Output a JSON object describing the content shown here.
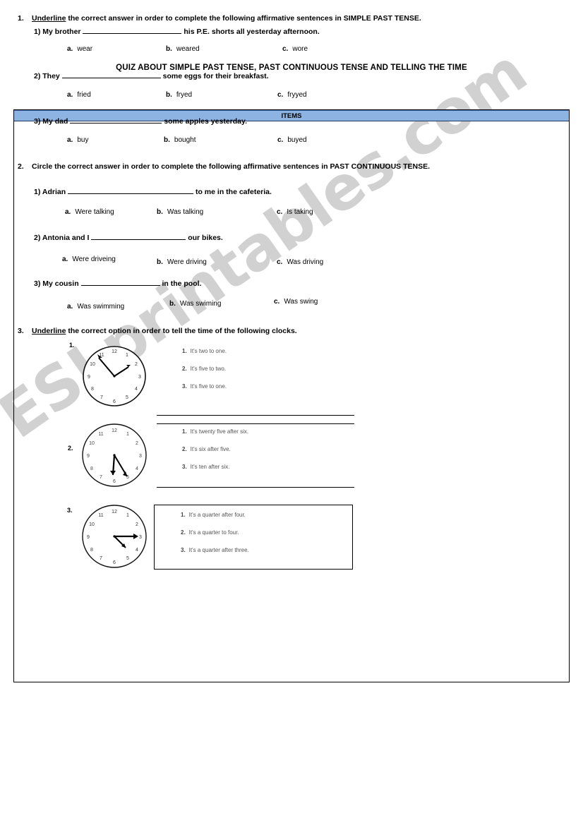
{
  "document": {
    "title": "QUIZ ABOUT SIMPLE PAST TENSE, PAST CONTINUOUS TENSE AND TELLING THE TIME",
    "watermark": "ESLprintables.com",
    "table_header": "ITEMS",
    "header_bg_color": "#8db3e2",
    "border_color": "#000000"
  },
  "sections": [
    {
      "number": "1.",
      "instruction_underlined": "Underline",
      "instruction_rest": " the correct answer in order to complete the following affirmative sentences in SIMPLE PAST TENSE.",
      "questions": [
        {
          "number": "1)",
          "before": "My brother",
          "after": "his P.E. shorts all yesterday afternoon.",
          "options": [
            {
              "letter": "a.",
              "text": "wear"
            },
            {
              "letter": "b.",
              "text": "weared"
            },
            {
              "letter": "c.",
              "text": "wore"
            }
          ]
        },
        {
          "number": "2)",
          "before": "They",
          "after": "some eggs for their breakfast.",
          "options": [
            {
              "letter": "a.",
              "text": "fried"
            },
            {
              "letter": "b.",
              "text": "fryed"
            },
            {
              "letter": "c.",
              "text": "fryyed"
            }
          ]
        },
        {
          "number": "3)",
          "before": "My dad",
          "after": "some apples yesterday.",
          "options": [
            {
              "letter": "a.",
              "text": "buy"
            },
            {
              "letter": "b.",
              "text": "bought"
            },
            {
              "letter": "c.",
              "text": "buyed"
            }
          ]
        }
      ]
    },
    {
      "number": "2.",
      "instruction_underlined": "",
      "instruction_rest": "Circle the correct answer in order to complete the following affirmative sentences in PAST CONTINUOUS TENSE.",
      "questions": [
        {
          "number": "1)",
          "before": "Adrian",
          "after": "to me in the cafeteria.",
          "options": [
            {
              "letter": "a.",
              "text": "Were talking"
            },
            {
              "letter": "b.",
              "text": "Was talking"
            },
            {
              "letter": "c.",
              "text": "Is taking"
            }
          ]
        },
        {
          "number": "2)",
          "before": "Antonia and I",
          "after": "our bikes.",
          "options": [
            {
              "letter": "a.",
              "text": "Were driveing"
            },
            {
              "letter": "b.",
              "text": "Were driving"
            },
            {
              "letter": "c.",
              "text": "Was driving"
            }
          ]
        },
        {
          "number": "3)",
          "before": "My cousin",
          "after": "in the pool.",
          "options": [
            {
              "letter": "a.",
              "text": "Was swimming"
            },
            {
              "letter": "b.",
              "text": "Was swiming"
            },
            {
              "letter": "c.",
              "text": "Was swing"
            }
          ]
        }
      ]
    },
    {
      "number": "3.",
      "instruction_underlined": "Underline",
      "instruction_rest": " the correct option in order to tell the time of the following clocks.",
      "questions": []
    }
  ],
  "clocks": [
    {
      "index": "1.",
      "hour_hand_angle": 27,
      "minute_hand_angle": 330,
      "options": [
        {
          "number": "1.",
          "text": "It's two to one."
        },
        {
          "number": "2.",
          "text": "It's five to two."
        },
        {
          "number": "3.",
          "text": "It's five to one."
        }
      ]
    },
    {
      "index": "2.",
      "hour_hand_angle": 192,
      "minute_hand_angle": 150,
      "options": [
        {
          "number": "1.",
          "text": "It's twenty five after six."
        },
        {
          "number": "2.",
          "text": "It's six after five."
        },
        {
          "number": "3.",
          "text": "It's ten after six."
        }
      ]
    },
    {
      "index": "3.",
      "hour_hand_angle": 128,
      "minute_hand_angle": 90,
      "options": [
        {
          "number": "1.",
          "text": "It's a quarter after four."
        },
        {
          "number": "2.",
          "text": "It's a quarter to four."
        },
        {
          "number": "3.",
          "text": "It's a quarter after three."
        }
      ]
    }
  ],
  "clock_numerals": [
    "12",
    "1",
    "2",
    "3",
    "4",
    "5",
    "6",
    "7",
    "8",
    "9",
    "10",
    "11"
  ]
}
